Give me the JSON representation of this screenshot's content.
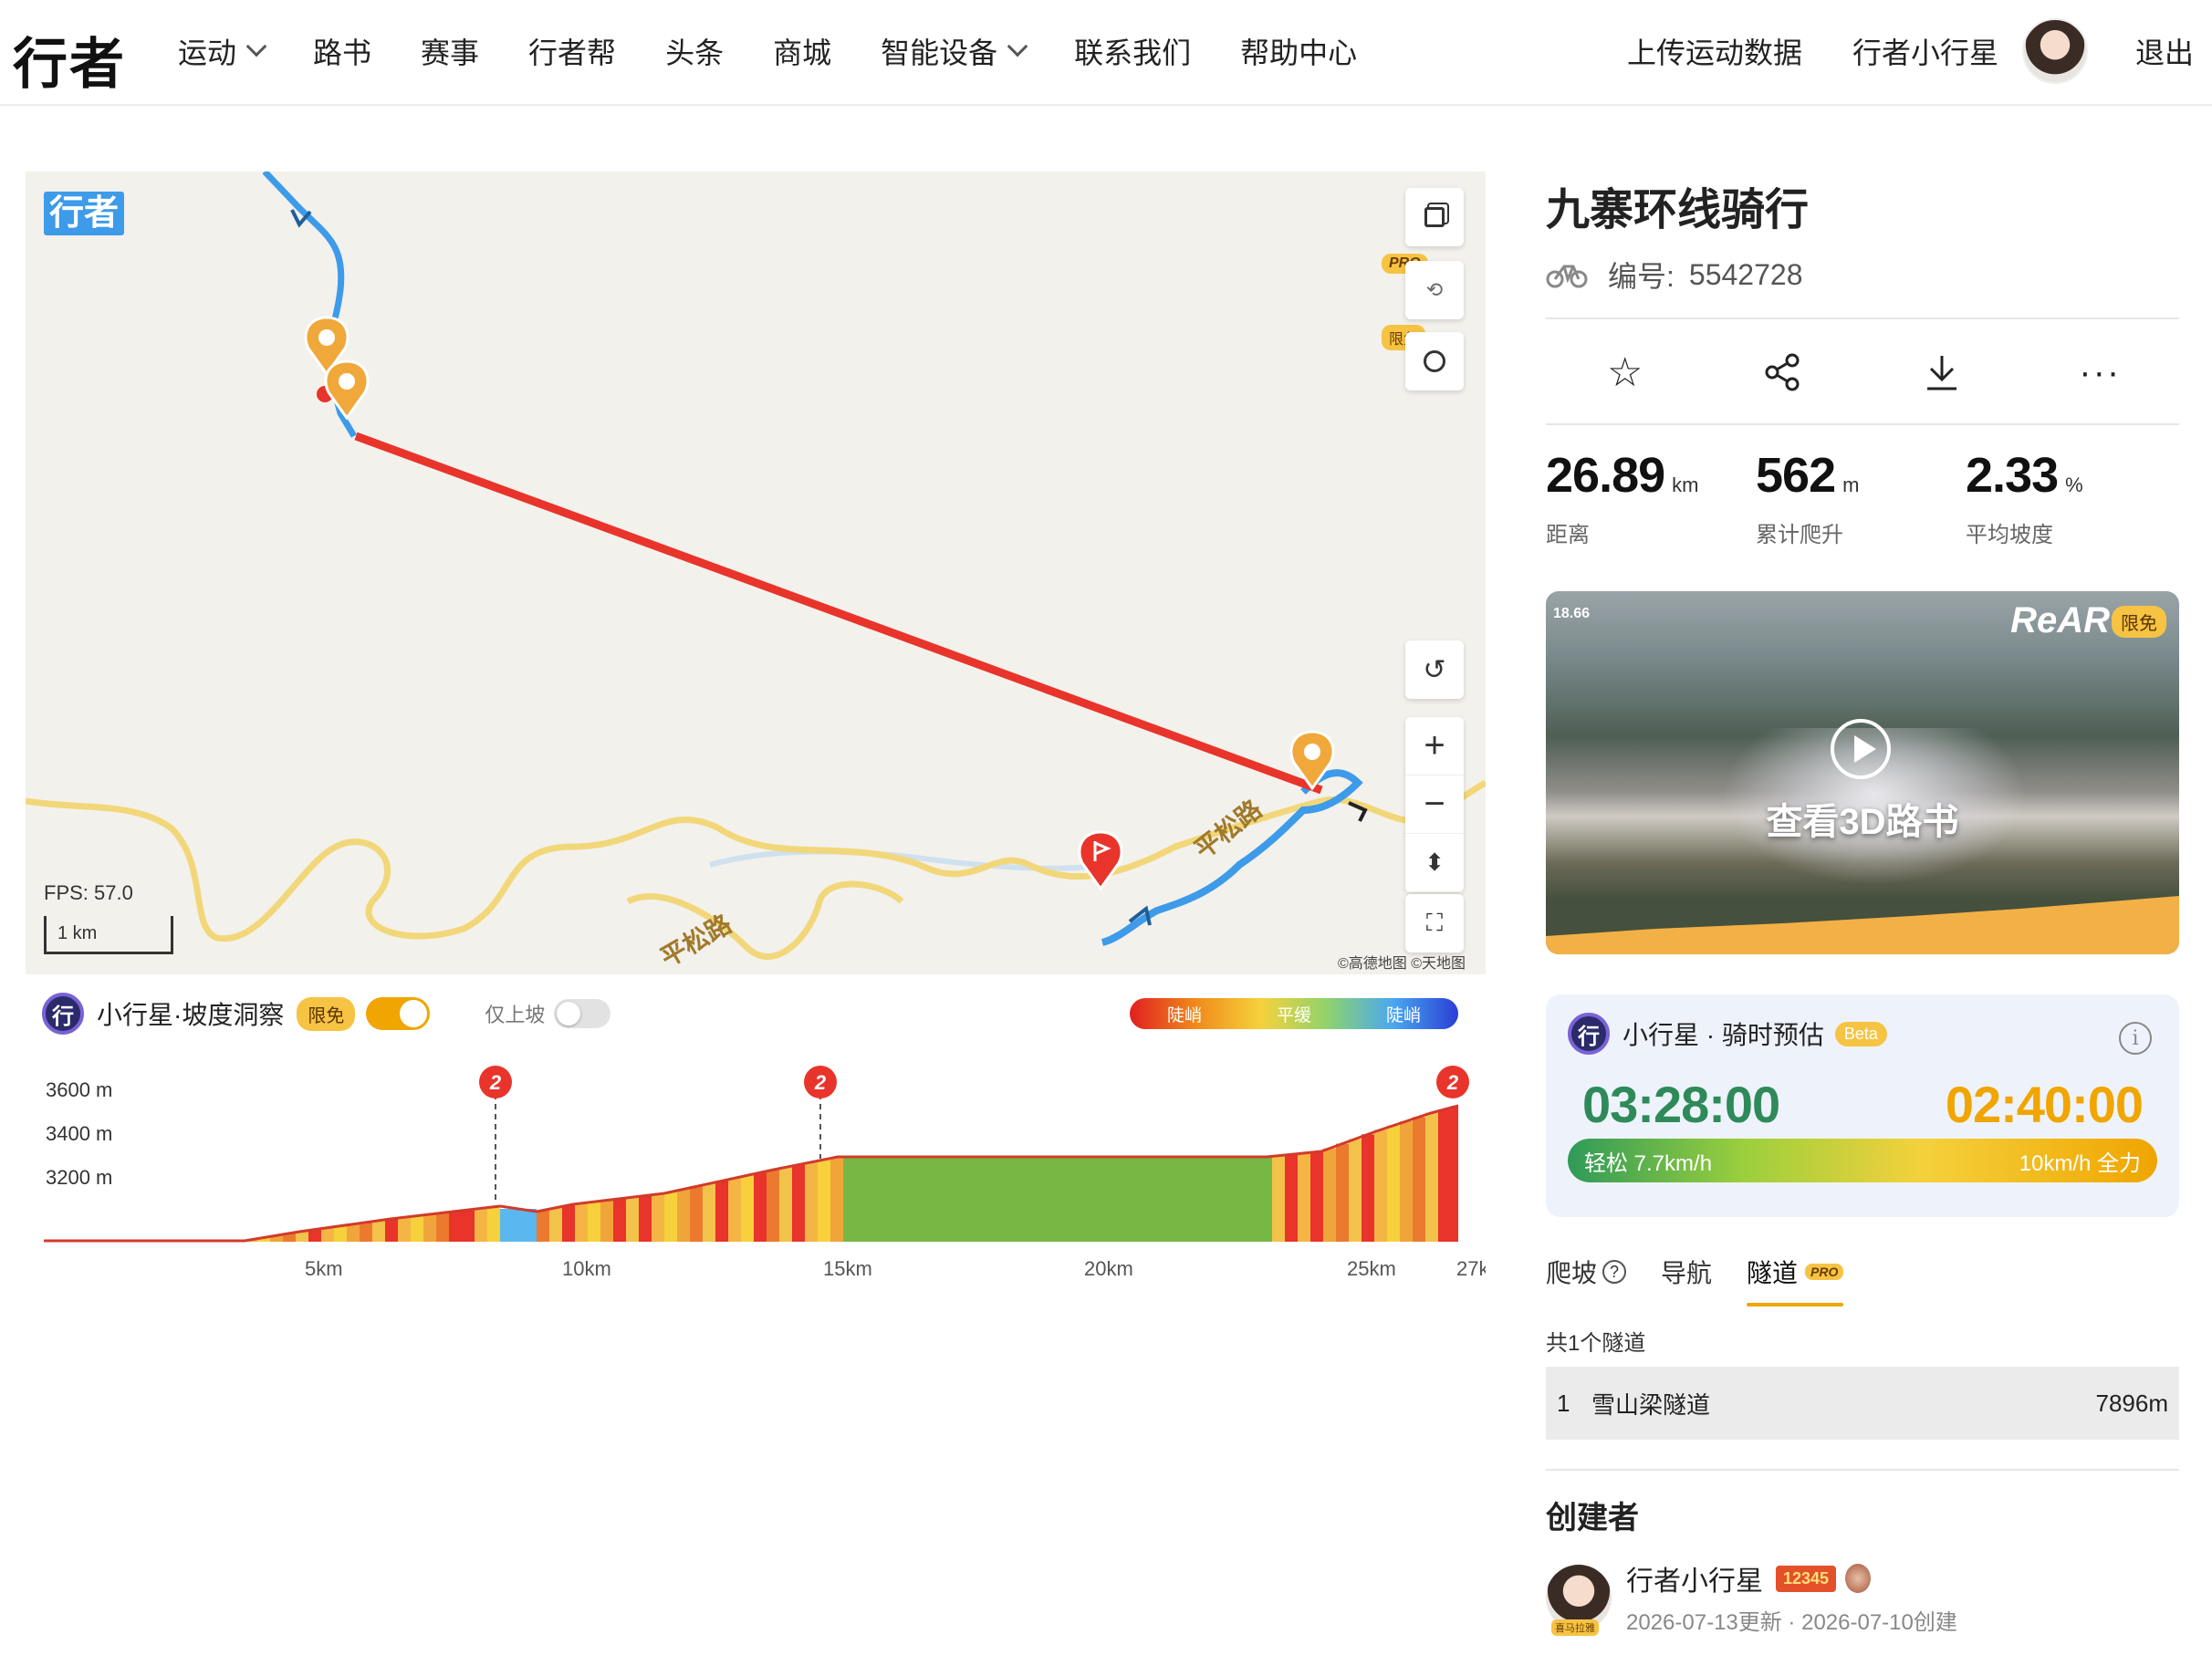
{
  "header": {
    "logo": "行者",
    "nav": [
      {
        "label": "运动",
        "dropdown": true
      },
      {
        "label": "路书",
        "dropdown": false
      },
      {
        "label": "赛事",
        "dropdown": false
      },
      {
        "label": "行者帮",
        "dropdown": false
      },
      {
        "label": "头条",
        "dropdown": false
      },
      {
        "label": "商城",
        "dropdown": false
      },
      {
        "label": "智能设备",
        "dropdown": true
      },
      {
        "label": "联系我们",
        "dropdown": false
      },
      {
        "label": "帮助中心",
        "dropdown": false
      }
    ],
    "upload": "上传运动数据",
    "username": "行者小行星",
    "logout": "退出"
  },
  "map": {
    "logo": "行者",
    "pro_tag": "PRO",
    "free_tag": "限免",
    "road_label": "平松路",
    "fps": "FPS: 57.0",
    "scale": "1 km",
    "attribution": "©高德地图  ©天地图",
    "colors": {
      "route_red": "#e8342a",
      "route_blue": "#3d9be9",
      "road": "#f2d77a",
      "marker": "#f0a83a"
    }
  },
  "elevation": {
    "title": "小行星·坡度洞察",
    "free_tag": "限免",
    "logo": "行",
    "uphill_only": "仅上坡",
    "legend": [
      "陡峭",
      "平缓",
      "陡峭"
    ],
    "y_labels": [
      "3600 m",
      "3400 m",
      "3200 m"
    ],
    "x_labels": [
      "5km",
      "10km",
      "15km",
      "20km",
      "25km",
      "27k"
    ],
    "climb_markers": [
      "2",
      "2",
      "2"
    ]
  },
  "route": {
    "title": "九寨环线骑行",
    "id_label": "编号:",
    "id": "5542728",
    "stats": [
      {
        "value": "26.89",
        "unit": "km",
        "label": "距离"
      },
      {
        "value": "562",
        "unit": "m",
        "label": "累计爬升"
      },
      {
        "value": "2.33",
        "unit": "%",
        "label": "平均坡度"
      }
    ]
  },
  "video": {
    "label": "查看3D路书",
    "brand": "ReAR",
    "free_tag": "限免",
    "speed": "18.66"
  },
  "estimate": {
    "title": "小行星 · 骑时预估",
    "beta": "Beta",
    "logo": "行",
    "easy_time": "03:28:00",
    "full_time": "02:40:00",
    "easy_label": "轻松 7.7km/h",
    "full_label": "10km/h 全力"
  },
  "tabs": {
    "climb": "爬坡",
    "nav": "导航",
    "tunnel": "隧道",
    "pro": "PRO"
  },
  "tunnels": {
    "count_label": "共1个隧道",
    "rows": [
      {
        "index": "1",
        "name": "雪山梁隧道",
        "length": "7896m"
      }
    ]
  },
  "creator": {
    "title": "创建者",
    "name": "行者小行星",
    "level": "12345",
    "avatar_badge": "喜马拉雅",
    "dates": "2026-07-13更新 · 2026-07-10创建"
  }
}
